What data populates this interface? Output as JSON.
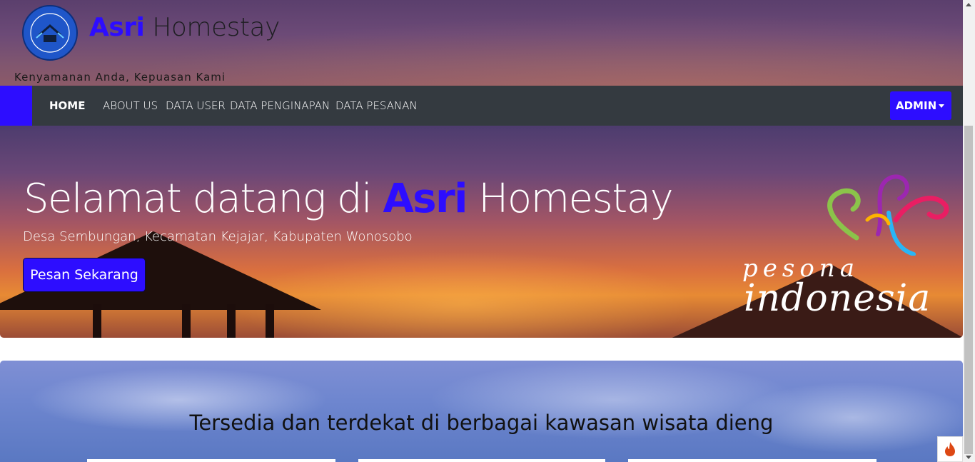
{
  "header": {
    "brand_accent": "Asri",
    "brand_rest": " Homestay",
    "tagline": "Kenyamanan Anda, Kepuasan Kami",
    "logo_text": "ASRI HOMESTAY"
  },
  "nav": {
    "items": [
      {
        "label": "HOME",
        "active": true
      },
      {
        "label": "ABOUT US"
      },
      {
        "label": "DATA USER"
      },
      {
        "label": "DATA PENGINAPAN"
      },
      {
        "label": "DATA PESANAN"
      }
    ],
    "admin_label": "ADMIN"
  },
  "hero": {
    "title_prefix": "Selamat datang di ",
    "title_accent": "Asri",
    "title_suffix": " Homestay",
    "subtitle": "Desa Sembungan, Kecamatan Kejajar, Kabupaten Wonosobo",
    "cta_label": "Pesan Sekarang",
    "logo_word1": "pesona",
    "logo_word2": "indonesia"
  },
  "section2": {
    "title": "Tersedia dan terdekat di berbagai kawasan wisata dieng"
  },
  "colors": {
    "accent": "#2d0dff",
    "navbar": "#343a40"
  }
}
